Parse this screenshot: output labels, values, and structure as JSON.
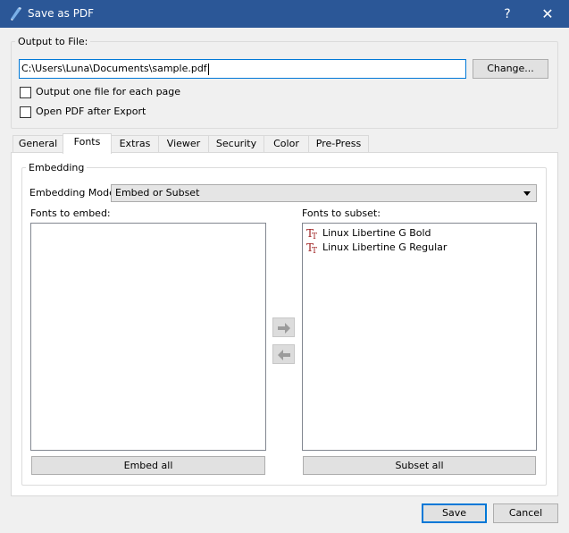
{
  "window": {
    "title": "Save as PDF",
    "help_label": "?",
    "close_label": "✕"
  },
  "output": {
    "group_label": "Output to File:",
    "path_value": "C:\\Users\\Luna\\Documents\\sample.pdf",
    "change_label": "Change...",
    "one_file_label": "Output one file for each page",
    "one_file_checked": false,
    "open_after_label": "Open PDF after Export",
    "open_after_checked": false
  },
  "tabs": [
    {
      "label": "General"
    },
    {
      "label": "Fonts",
      "active": true
    },
    {
      "label": "Extras"
    },
    {
      "label": "Viewer"
    },
    {
      "label": "Security"
    },
    {
      "label": "Color"
    },
    {
      "label": "Pre-Press"
    }
  ],
  "fonts": {
    "group_label": "Embedding",
    "mode_label": "Embedding Mode:",
    "mode_value": "Embed or Subset",
    "embed_list_label": "Fonts to embed:",
    "embed_items": [],
    "subset_list_label": "Fonts to subset:",
    "subset_items": [
      "Linux Libertine G Bold",
      "Linux Libertine G Regular"
    ],
    "embed_all_label": "Embed all",
    "subset_all_label": "Subset all"
  },
  "footer": {
    "save_label": "Save",
    "cancel_label": "Cancel"
  },
  "colors": {
    "titlebar": "#2b5797",
    "focus": "#0078d7",
    "font_icon": "#9c1c1c"
  }
}
